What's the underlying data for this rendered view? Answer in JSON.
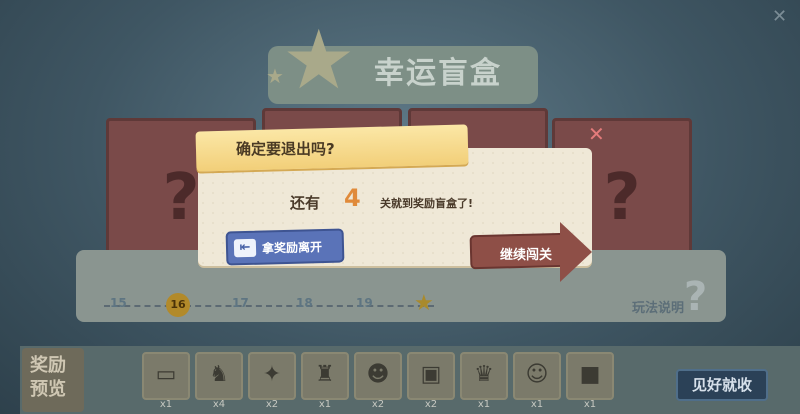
{
  "header": {
    "title": "幸运盲盒"
  },
  "progress": {
    "levels": [
      "15",
      "16",
      "17",
      "18",
      "19"
    ],
    "current_level": "16"
  },
  "rules_label": "玩法说明",
  "mystery_box_glyph": "?",
  "rewards": {
    "label": "奖励预览",
    "items": [
      {
        "icon": "ticket-card-icon",
        "count": "x1"
      },
      {
        "icon": "cow-figure-icon",
        "count": "x4"
      },
      {
        "icon": "puzzle-piece-icon",
        "count": "x2"
      },
      {
        "icon": "cow-outfit-icon",
        "count": "x1"
      },
      {
        "icon": "hat-character-icon",
        "count": "x2"
      },
      {
        "icon": "picture-frame-icon",
        "count": "x2"
      },
      {
        "icon": "costume-character-icon",
        "count": "x1"
      },
      {
        "icon": "cat-character-icon",
        "count": "x1"
      },
      {
        "icon": "gift-box-icon",
        "count": "x1"
      }
    ],
    "confirm_label": "见好就收"
  },
  "dialog": {
    "title": "确定要退出吗?",
    "message_pre": "还有",
    "remaining_count": "4",
    "message_post": "关就到奖励盲盒了!",
    "leave_label": "拿奖励离开",
    "continue_label": "继续闯关"
  },
  "colors": {
    "accent_orange": "#e08a3a",
    "leave_button": "#5a73b8",
    "continue_button": "#8e4f47"
  }
}
